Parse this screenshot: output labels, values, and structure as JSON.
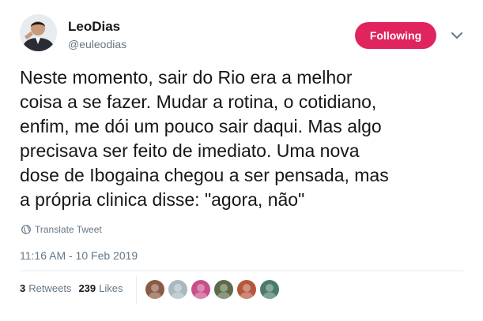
{
  "author": {
    "display_name": "LeoDias",
    "handle": "@euleodias",
    "avatar_icon": "profile-photo"
  },
  "follow_button": {
    "label": "Following",
    "color": "#e0245e"
  },
  "menu": {
    "icon": "chevron-down-icon"
  },
  "tweet": {
    "text": "Neste momento, sair do Rio era a melhor\ncoisa a se fazer. Mudar a rotina, o cotidiano,\nenfim, me dói um pouco sair daqui. Mas algo\nprecisava ser feito de imediato. Uma nova\ndose de Ibogaina chegou a ser pensada, mas\na própria clinica disse: \"agora, não\"",
    "translate_label": "Translate Tweet",
    "timestamp": "11:16 AM - 10 Feb 2019"
  },
  "stats": {
    "retweets_count": "3",
    "retweets_label": "Retweets",
    "likes_count": "239",
    "likes_label": "Likes"
  },
  "likers": [
    {
      "name": "liker-1",
      "color": "#8a5a44"
    },
    {
      "name": "liker-2",
      "color": "#aab8c2"
    },
    {
      "name": "liker-3",
      "color": "#c94f8a"
    },
    {
      "name": "liker-4",
      "color": "#5b6b4a"
    },
    {
      "name": "liker-5",
      "color": "#b5563d"
    },
    {
      "name": "liker-6",
      "color": "#4a7a6a"
    }
  ]
}
